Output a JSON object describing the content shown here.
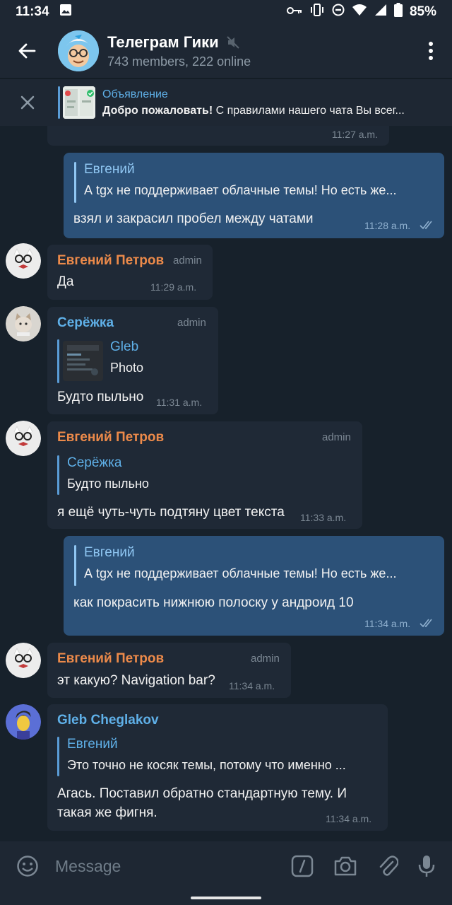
{
  "status_bar": {
    "time": "11:34",
    "battery": "85%"
  },
  "header": {
    "title": "Телеграм Гики",
    "subtitle": "743 members, 222 online"
  },
  "pinned": {
    "title": "Объявление",
    "bold": "Добро пожаловать!",
    "text": " С правилами нашего чата Вы всег..."
  },
  "messages": [
    {
      "time": "11:27 a.m."
    },
    {
      "reply_name": "Евгений",
      "reply_text": "А tgx не поддерживает облачные темы!  Но есть же...",
      "text": "взял и закрасил пробел между чатами",
      "time": "11:28 a.m."
    },
    {
      "author": "Евгений Петров",
      "role": "admin",
      "text": "Да",
      "time": "11:29 a.m."
    },
    {
      "author": "Серёжка",
      "role": "admin",
      "reply_name": "Gleb",
      "reply_text": "Photo",
      "text": "Будто пыльно",
      "time": "11:31 a.m."
    },
    {
      "author": "Евгений Петров",
      "role": "admin",
      "reply_name": "Серёжка",
      "reply_text": "Будто пыльно",
      "text": "я ещё чуть-чуть подтяну цвет текста",
      "time": "11:33 a.m."
    },
    {
      "reply_name": "Евгений",
      "reply_text": "А tgx не поддерживает облачные темы!  Но есть же...",
      "text": "как покрасить нижнюю полоску у андроид 10",
      "time": "11:34 a.m."
    },
    {
      "author": "Евгений Петров",
      "role": "admin",
      "text": "эт какую? Navigation bar?",
      "time": "11:34 a.m."
    },
    {
      "author": "Gleb Cheglakov",
      "reply_name": "Евгений",
      "reply_text": "Это точно не косяк темы, потому что именно ...",
      "text_line1": "Агась. Поставил обратно стандартную тему. И",
      "text_line2": "такая же фигня.",
      "time": "11:34 a.m."
    }
  ],
  "composer": {
    "placeholder": "Message"
  },
  "colors": {
    "background": "#17212b",
    "bar": "#1e2733",
    "incoming": "#1f2936",
    "outgoing": "#2c5178",
    "accent": "#5fb0e8",
    "orange_name": "#ec8a4a"
  }
}
